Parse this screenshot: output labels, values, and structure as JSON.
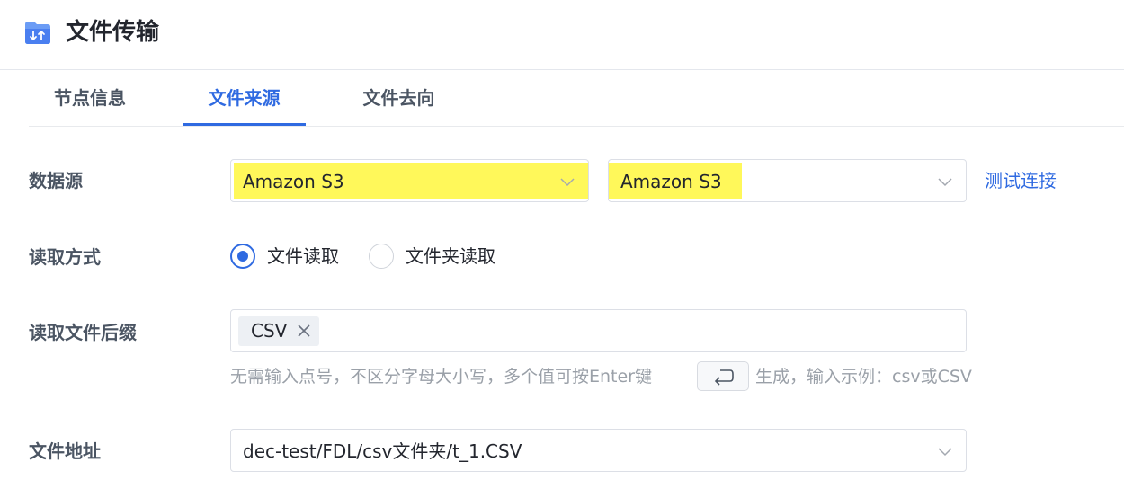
{
  "header": {
    "title": "文件传输",
    "icon": "folder-transfer-icon",
    "more_label": "···"
  },
  "tabs": [
    {
      "label": "节点信息",
      "active": false
    },
    {
      "label": "文件来源",
      "active": true
    },
    {
      "label": "文件去向",
      "active": false
    }
  ],
  "form": {
    "datasource": {
      "label": "数据源",
      "type_value": "Amazon S3",
      "connection_value": "Amazon S3",
      "test_link": "测试连接"
    },
    "read_mode": {
      "label": "读取方式",
      "options": [
        {
          "label": "文件读取",
          "checked": true
        },
        {
          "label": "文件夹读取",
          "checked": false
        }
      ]
    },
    "suffix": {
      "label": "读取文件后缀",
      "tags": [
        "CSV"
      ],
      "hint_before": "无需输入点号，不区分字母大小写，多个值可按Enter键",
      "hint_after": "生成，输入示例：csv或CSV"
    },
    "file_path": {
      "label": "文件地址",
      "value": "dec-test/FDL/csv文件夹/t_1.CSV"
    }
  },
  "colors": {
    "accent": "#2f6ae1",
    "highlight": "#fff85a",
    "border": "#dcdfe6"
  }
}
